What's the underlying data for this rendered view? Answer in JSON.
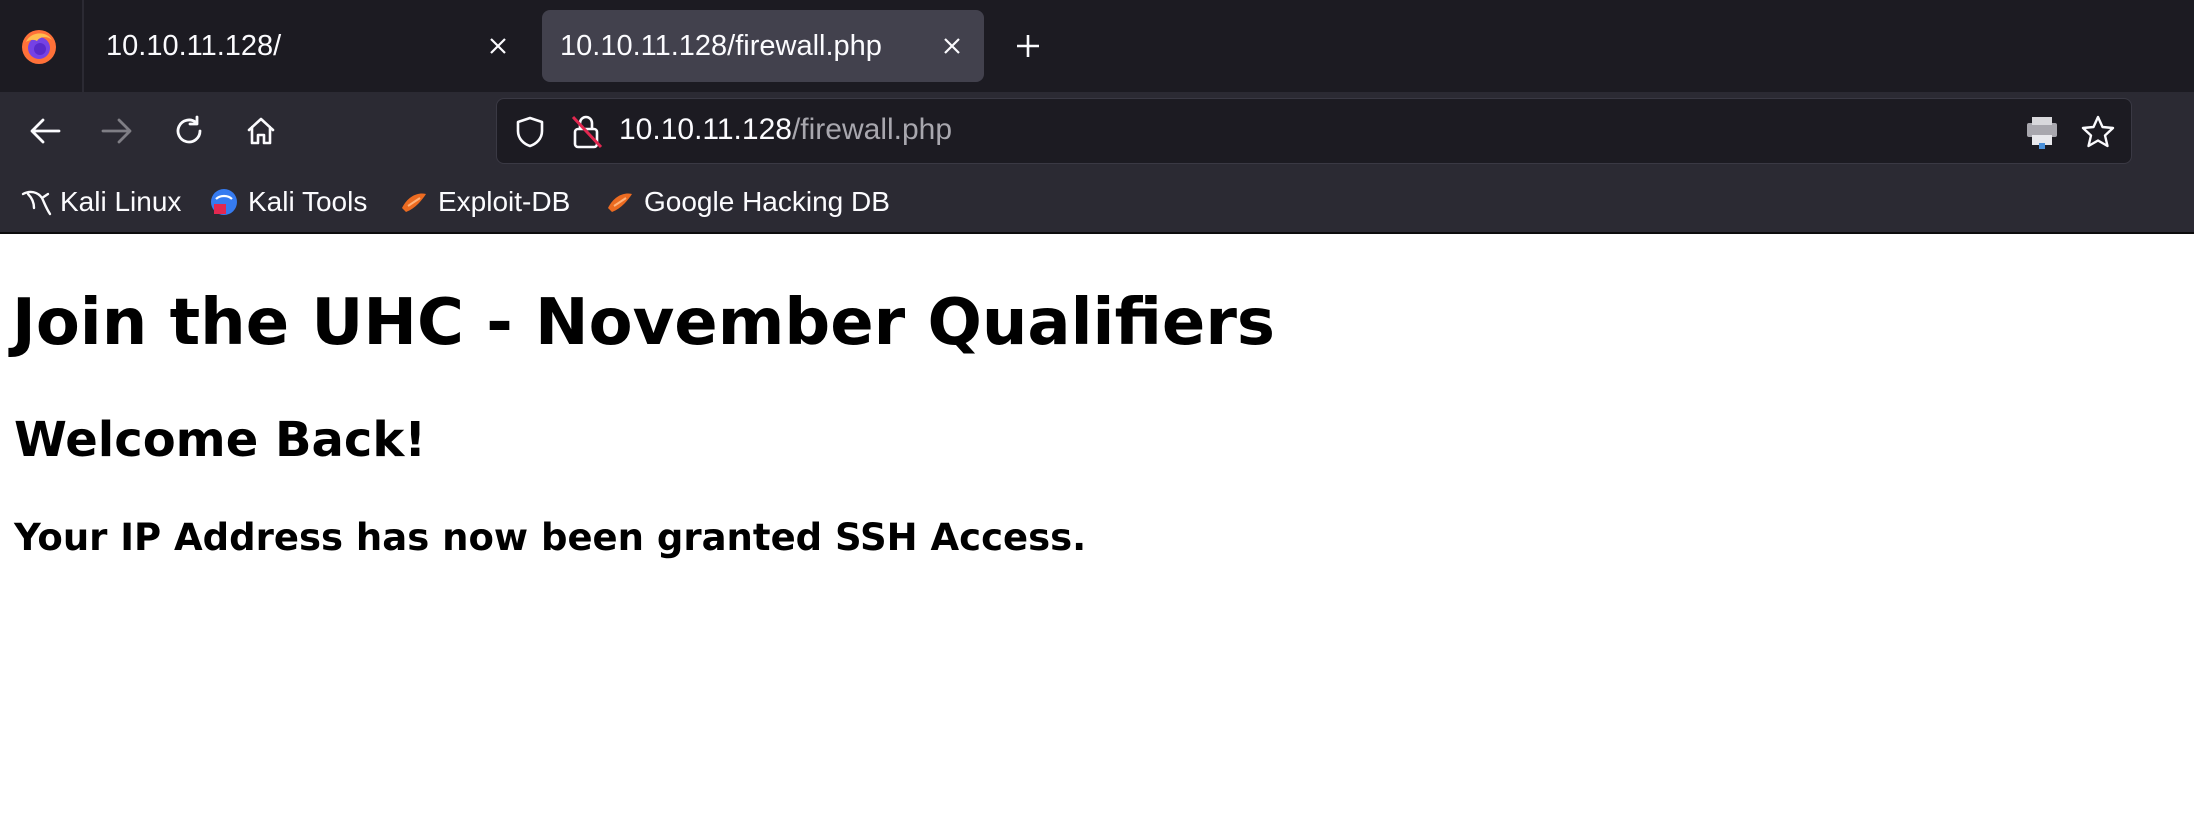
{
  "browser": {
    "tabs": [
      {
        "title": "10.10.11.128/",
        "active": false
      },
      {
        "title": "10.10.11.128/firewall.php",
        "active": true
      }
    ],
    "urlbar": {
      "host": "10.10.11.128",
      "path": "/firewall.php"
    },
    "bookmarks": [
      {
        "label": "Kali Linux",
        "icon": "kali-dragon-icon"
      },
      {
        "label": "Kali Tools",
        "icon": "kali-tools-icon"
      },
      {
        "label": "Exploit-DB",
        "icon": "exploit-db-icon"
      },
      {
        "label": "Google Hacking DB",
        "icon": "ghdb-icon"
      }
    ],
    "colors": {
      "tabstrip_bg": "#1c1b22",
      "toolbar_bg": "#2b2a33",
      "active_tab_bg": "#42414d",
      "text": "#fbfbfe"
    }
  },
  "page": {
    "heading": "Join the UHC - November Qualifiers",
    "subheading": "Welcome Back!",
    "message": "Your IP Address has now been granted SSH Access."
  }
}
